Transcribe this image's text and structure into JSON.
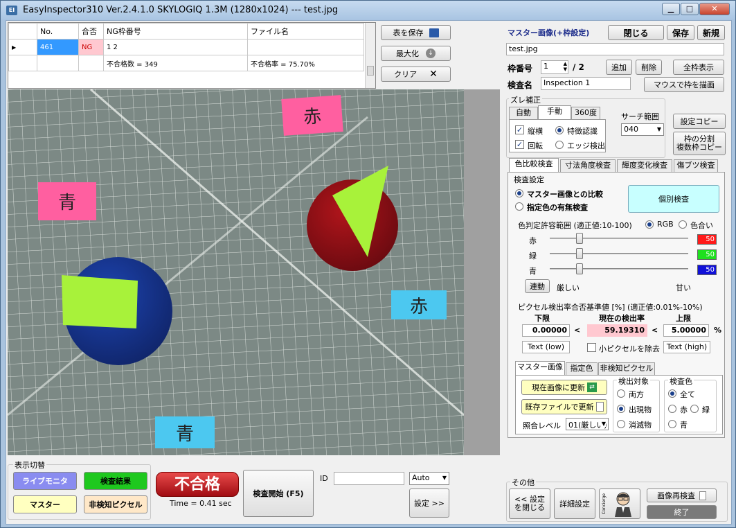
{
  "window": {
    "title": "EasyInspector310 Ver.2.4.1.0 SKYLOGIQ 1.3M  (1280x1024) --- test.jpg",
    "icon_label": "EI",
    "minimize": "▁",
    "maximize": "□",
    "close": "✕"
  },
  "results_table": {
    "headers": [
      "No.",
      "合否",
      "NG枠番号",
      "ファイル名"
    ],
    "rows": [
      {
        "no": "461",
        "result": "NG",
        "ng_frame": "1 2",
        "file": ""
      },
      {
        "no": "",
        "result": "",
        "ng_frame": "不合格数 = 349",
        "file": "不合格率 = 75.70%"
      }
    ],
    "row_marker": "▶"
  },
  "table_buttons": {
    "save": "表を保存",
    "maximize": "最大化",
    "clear": "クリア"
  },
  "image_labels": {
    "note1": "赤",
    "note2": "青",
    "note3": "赤",
    "note4": "青"
  },
  "master": {
    "title": "マスター画像(+枠設定)",
    "close": "閉じる",
    "save": "保存",
    "new": "新規",
    "filename": "test.jpg",
    "frame_label": "枠番号",
    "frame_value": "1",
    "frame_total": "/ 2",
    "add": "追加",
    "delete": "削除",
    "show_all": "全枠表示",
    "inspection_label": "検査名",
    "inspection_name": "Inspection 1",
    "draw_with_mouse": "マウスで枠を描画"
  },
  "shift": {
    "group": "ズレ補正",
    "tabs": [
      "自動",
      "手動",
      "360度"
    ],
    "vertical": "縦横",
    "rotation": "回転",
    "feature": "特徴認識",
    "edge": "エッジ検出",
    "search_label": "サーチ範囲",
    "search_value": "040",
    "copy_settings": "設定コピー",
    "split_line1": "枠の分割",
    "split_line2": "複数枠コピー"
  },
  "inspect_tabs": [
    "色比較検査",
    "寸法角度検査",
    "輝度変化検査",
    "傷ブツ検査"
  ],
  "color_inspect": {
    "settings_group": "検査設定",
    "compare_master": "マスター画像との比較",
    "specified_color": "指定色の有無検査",
    "individual": "個別検査",
    "range_label": "色判定許容範囲 (適正値:10-100)",
    "rgb": "RGB",
    "hue": "色合い",
    "red": "赤",
    "green": "緑",
    "blue": "青",
    "red_value": "50",
    "green_value": "50",
    "blue_value": "50",
    "red_level": 0.2,
    "green_level": 0.2,
    "blue_level": 0.2,
    "link": "連動",
    "strict": "厳しい",
    "loose": "甘い",
    "pixel_group": "ピクセル検出率合否基準値 [%] (適正値:0.01%-10%)",
    "lower": "下限",
    "current": "現在の検出率",
    "upper": "上限",
    "lower_value": "0.00000",
    "current_value": "59.19310",
    "upper_value": "5.00000",
    "lt": "<",
    "percent": "%",
    "text_low": "Text (low)",
    "remove_small": "小ピクセルを除去",
    "text_high": "Text (high)"
  },
  "sub_tabs": [
    "マスター画像",
    "指定色",
    "非検知ピクセル"
  ],
  "master_tab": {
    "update_current": "現在画像に更新",
    "update_file": "既存ファイルで更新",
    "match_label": "照合レベル",
    "match_value": "01(厳しい)",
    "detect_group": "検出対象",
    "both": "両方",
    "appeared": "出現物",
    "disappeared": "消滅物",
    "color_group": "検査色",
    "all": "全て",
    "c_red": "赤",
    "c_green": "緑",
    "c_blue": "青"
  },
  "display": {
    "group": "表示切替",
    "live": "ライブモニタ",
    "result": "検査結果",
    "master": "マスター",
    "undetected": "非検知ピクセル"
  },
  "status": {
    "verdict": "不合格",
    "time": "Time = 0.41 sec",
    "start": "検査開始 (F5)",
    "id_label": "ID",
    "id_value": "",
    "auto": "Auto",
    "settings": "設定 >>"
  },
  "other": {
    "group": "その他",
    "close_settings_1": "<< 設定",
    "close_settings_2": "を閉じる",
    "detail": "詳細設定",
    "concierge": "Concierge",
    "reinspect": "画像再検査",
    "exit": "終了"
  },
  "colors": {
    "red_box": "#ff1a1a",
    "green_box": "#1ee01e",
    "blue_box": "#1010d8",
    "verdict_red": "#c8161c",
    "live_bg": "#8a8cf0",
    "result_bg": "#1ec81e",
    "master_bg": "#ffffc0",
    "undetected_bg": "#ffe8c8",
    "individual_bg": "#c8ffff",
    "ng_cell": "#ffc8d0",
    "no_cell": "#3399ff"
  }
}
